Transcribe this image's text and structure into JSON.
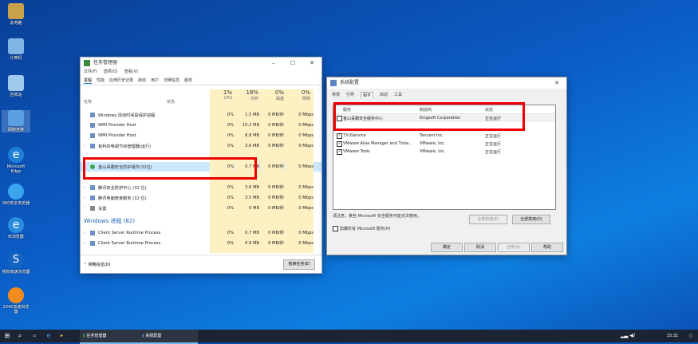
{
  "desktop_icons": [
    {
      "label": "此电脑"
    },
    {
      "label": "计算机"
    },
    {
      "label": "回收站"
    },
    {
      "label": "网络连接"
    },
    {
      "label": "Microsoft Edge"
    },
    {
      "label": "360安全浏览器"
    },
    {
      "label": "IE浏览器"
    },
    {
      "label": "搜狗高速浏览器"
    },
    {
      "label": "2345加速浏览器"
    }
  ],
  "task_manager": {
    "title": "任务管理器",
    "menu": [
      "文件(F)",
      "选项(O)",
      "查看(V)"
    ],
    "tabs": [
      "进程",
      "性能",
      "应用历史记录",
      "启动",
      "用户",
      "详细信息",
      "服务"
    ],
    "col_name": "名称",
    "col_status": "状态",
    "columns": [
      {
        "pct": "1%",
        "label": "CPU"
      },
      {
        "pct": "18%",
        "label": "内存"
      },
      {
        "pct": "0%",
        "label": "磁盘"
      },
      {
        "pct": "0%",
        "label": "网络"
      }
    ],
    "rows": [
      {
        "name": "Windows 活动时间段保护进程",
        "cpu": "0%",
        "mem": "1.5 MB",
        "disk": "0 MB/秒",
        "net": "0 Mbps"
      },
      {
        "name": "WMI Provider Host",
        "cpu": "0%",
        "mem": "15.2 MB",
        "disk": "0 MB/秒",
        "net": "0 Mbps"
      },
      {
        "name": "WMI Provider Host",
        "cpu": "0%",
        "mem": "8.8 MB",
        "disk": "0 MB/秒",
        "net": "0 Mbps"
      },
      {
        "name": "有利的电视节目管理器(运行)",
        "cpu": "0%",
        "mem": "3.6 MB",
        "disk": "0 MB/秒",
        "net": "0 Mbps"
      },
      {
        "name": "金山毒霸安全防护组件(32位)",
        "cpu": "0%",
        "mem": "0.7 MB",
        "disk": "0 MB/秒",
        "net": "0 Mbps"
      },
      {
        "name": "腾讯安全防护中心 (32 位)",
        "cpu": "0%",
        "mem": "3.6 MB",
        "disk": "0 MB/秒",
        "net": "0 Mbps"
      },
      {
        "name": "腾讯电脑管家服务 (32 位)",
        "cpu": "0%",
        "mem": "3.5 MB",
        "disk": "0 MB/秒",
        "net": "0 Mbps"
      },
      {
        "name": "设置",
        "cpu": "0%",
        "mem": "0 MB",
        "disk": "0 MB/秒",
        "net": "0 Mbps"
      }
    ],
    "group_windows": "Windows 进程 (82)",
    "win_rows": [
      {
        "name": "Client Server Runtime Process",
        "cpu": "0%",
        "mem": "0.7 MB",
        "disk": "0 MB/秒",
        "net": "0 Mbps"
      },
      {
        "name": "Client Server Runtime Process",
        "cpu": "0%",
        "mem": "0.9 MB",
        "disk": "0 MB/秒",
        "net": "0 Mbps"
      }
    ],
    "fewer_details": "简略信息(D)",
    "end_task": "结束任务(E)"
  },
  "msconfig": {
    "title": "系统配置",
    "tabs": [
      "常规",
      "引导",
      "服务",
      "启动",
      "工具"
    ],
    "headers": {
      "service": "服务",
      "vendor": "制造商",
      "status": "状态"
    },
    "services": [
      {
        "name": "金山毒霸安全服务中心",
        "vendor": "Kingsoft Corporation",
        "status": "正在运行",
        "checked": false
      },
      {
        "name": "TXUService",
        "vendor": "Tencent Inc.",
        "status": "正在运行",
        "checked": true
      },
      {
        "name": "VMware Alias Manager and Ticke...",
        "vendor": "VMware, Inc.",
        "status": "正在运行",
        "checked": true
      },
      {
        "name": "VMware Tools",
        "vendor": "VMware, Inc.",
        "status": "正在运行",
        "checked": true
      }
    ],
    "note": "请注意，某些 Microsoft 安全服务可能无法禁用。",
    "hide_ms": "隐藏所有 Microsoft 服务(H)",
    "enable_all": "全部启用(E)",
    "disable_all": "全部禁用(D)",
    "ok": "确定",
    "cancel": "取消",
    "apply": "应用(A)",
    "help": "帮助"
  },
  "taskbar": {
    "apps": [
      "任务管理器",
      "系统配置"
    ],
    "time": "15:31",
    "date": "2021/x/x"
  }
}
